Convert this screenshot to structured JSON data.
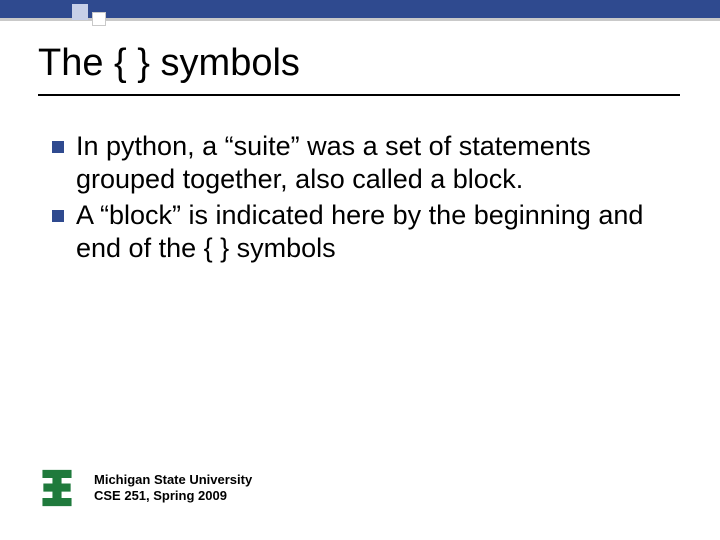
{
  "header": {
    "title": "The { } symbols"
  },
  "bullets": [
    {
      "text": "In python, a “suite” was a set of statements grouped together, also called a block."
    },
    {
      "text": "A “block” is indicated here by the beginning and end of the { } symbols"
    }
  ],
  "footer": {
    "line1": "Michigan State University",
    "line2": "CSE 251, Spring 2009"
  },
  "colors": {
    "accent": "#2f4a8f",
    "logo_green": "#1f7a3c"
  }
}
